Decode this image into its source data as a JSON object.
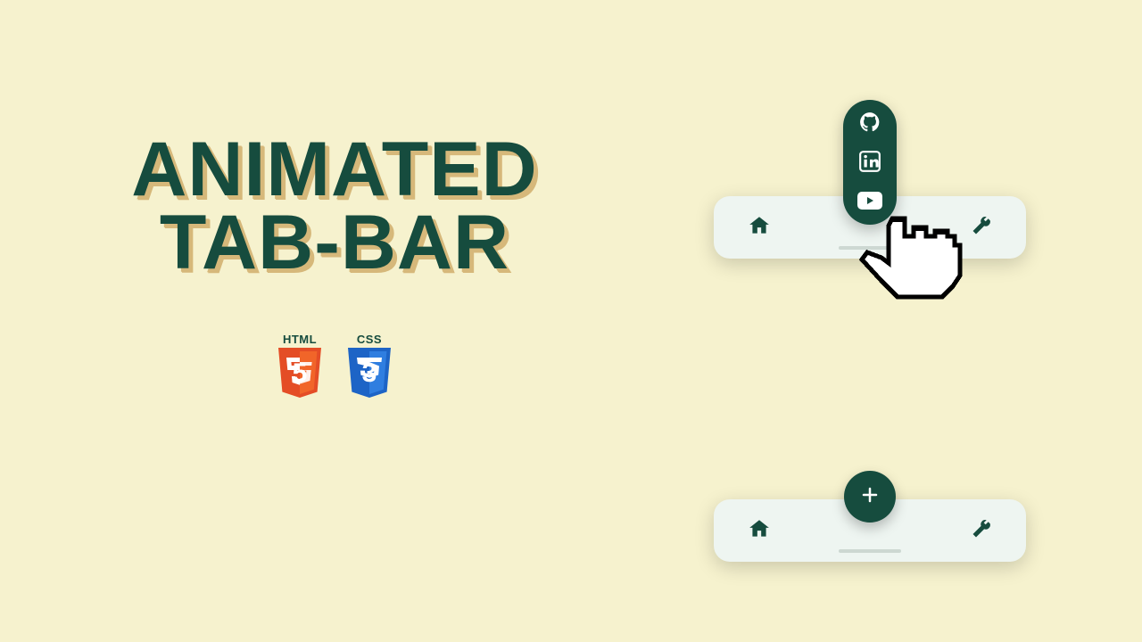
{
  "title": {
    "line1": "ANIMATED",
    "line2": "TAB-BAR"
  },
  "tech": {
    "html": {
      "label": "HTML",
      "num": "5"
    },
    "css": {
      "label": "CSS",
      "num": "3"
    }
  },
  "tabbar_expanded": {
    "icons": {
      "left": "home-icon",
      "right": "wrench-icon"
    },
    "popup": {
      "items": [
        {
          "name": "github-icon"
        },
        {
          "name": "linkedin-icon"
        },
        {
          "name": "youtube-icon"
        }
      ]
    }
  },
  "tabbar_collapsed": {
    "icons": {
      "left": "home-icon",
      "right": "wrench-icon"
    },
    "fab": {
      "icon": "plus-icon"
    }
  }
}
